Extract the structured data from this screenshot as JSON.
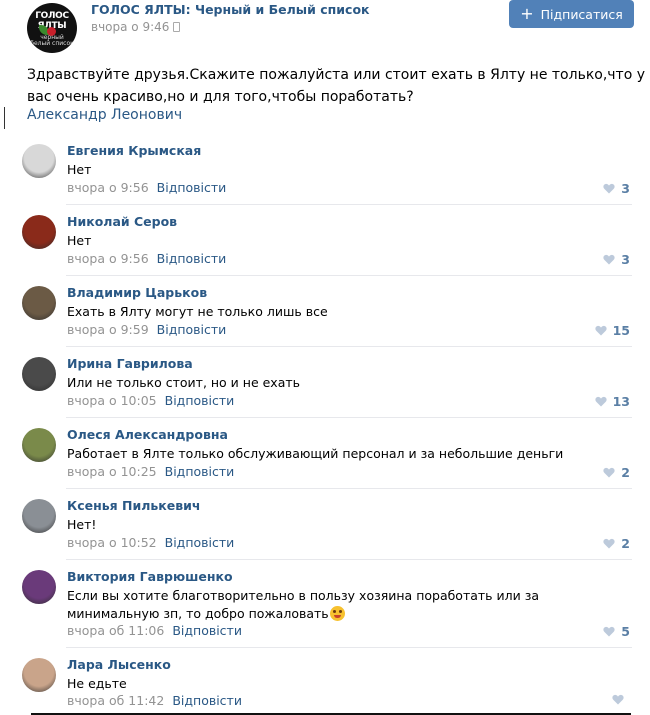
{
  "group": {
    "name": "ГОЛОС ЯЛТЫ: Черный и Белый список",
    "time": "вчора о 9:46",
    "avatar_text_top": "ГОЛОС ЯЛТЫ",
    "avatar_text_bottom": "черный белый список"
  },
  "subscribe_button": {
    "label": "Підписатися",
    "icon": "plus-icon"
  },
  "post": {
    "text": "Здравствуйте друзья.Скажите пожалуйста или стоит ехать в Ялту не только,что у вас очень красиво,но и для того,чтобы поработать?",
    "author": "Александр Леонович"
  },
  "reply_label": "Відповісти",
  "colors": {
    "link": "#2a5885",
    "meta": "#939393",
    "button": "#5181b8",
    "divider": "#e7e8ec"
  },
  "comments": [
    {
      "name": "Евгения Крымская",
      "text": "Нет",
      "time": "вчора о 9:56",
      "likes": "3",
      "avatar_color": "#d8d8d8"
    },
    {
      "name": "Николай Серов",
      "text": "Нет",
      "time": "вчора о 9:56",
      "likes": "3",
      "avatar_color": "#8a2a1a"
    },
    {
      "name": "Владимир Царьков",
      "text": "Ехать в Ялту могут не только лишь все",
      "time": "вчора о 9:59",
      "likes": "15",
      "avatar_color": "#6b5a45"
    },
    {
      "name": "Ирина Гаврилова",
      "text": "Или не только стоит, но и не ехать",
      "time": "вчора о 10:05",
      "likes": "13",
      "avatar_color": "#4a4a4a"
    },
    {
      "name": "Олеся Александровна",
      "text": "Работает в Ялте только обслуживающий персонал и за небольшие деньги",
      "time": "вчора о 10:25",
      "likes": "2",
      "avatar_color": "#7a8a4a"
    },
    {
      "name": "Ксенья Пилькевич",
      "text": "Нет!",
      "time": "вчора о 10:52",
      "likes": "2",
      "avatar_color": "#8a8f95"
    },
    {
      "name": "Виктория Гаврюшенко",
      "text": "Если вы хотите благотворительно в пользу хозяина поработать или за минимальную зп, то добро пожаловать",
      "emoji": "grinning-emoji-icon",
      "time": "вчора об 11:06",
      "likes": "5",
      "avatar_color": "#6a3a7a"
    },
    {
      "name": "Лара Лысенко",
      "text": "Не едьте",
      "time": "вчора об 11:42",
      "likes": "",
      "avatar_color": "#c9a48a"
    }
  ]
}
